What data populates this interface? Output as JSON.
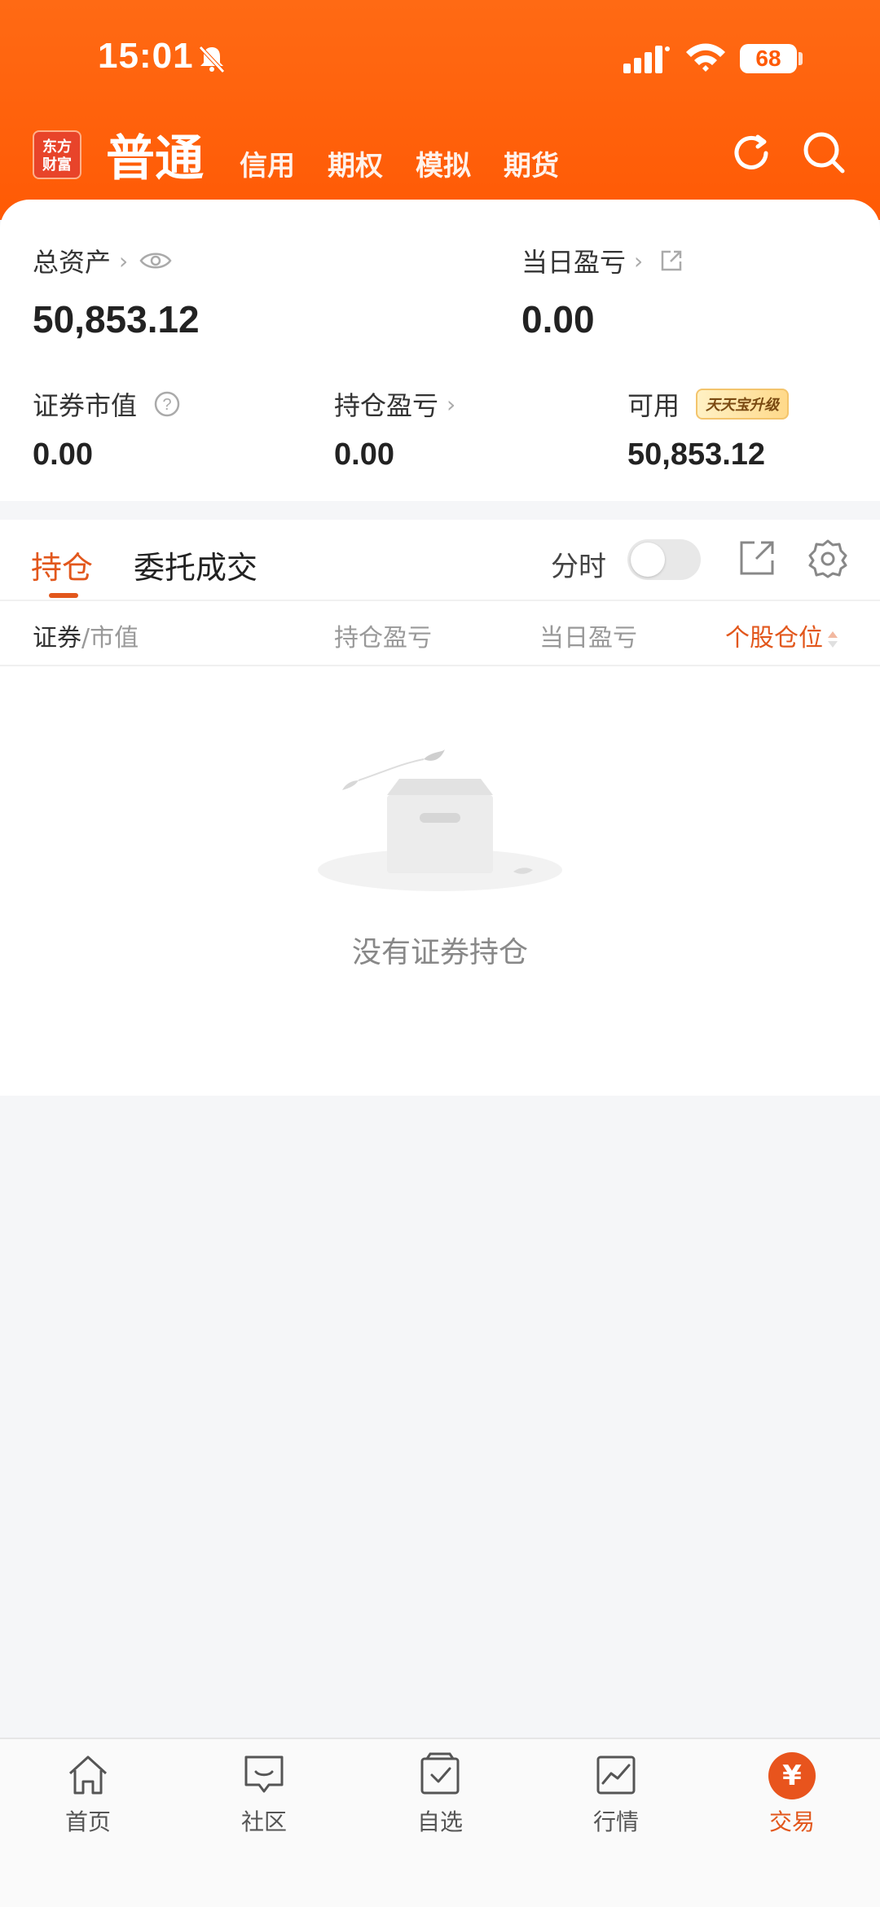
{
  "status_bar": {
    "time": "15:01",
    "battery": "68"
  },
  "header": {
    "logo_text": "东方\n财富",
    "tabs": [
      {
        "label": "普通",
        "active": true
      },
      {
        "label": "信用",
        "active": false
      },
      {
        "label": "期权",
        "active": false
      },
      {
        "label": "模拟",
        "active": false
      },
      {
        "label": "期货",
        "active": false
      }
    ]
  },
  "summary": {
    "total_assets_label": "总资产",
    "total_assets_value": "50,853.12",
    "daily_pnl_label": "当日盈亏",
    "daily_pnl_value": "0.00",
    "market_value_label": "证券市值",
    "market_value_value": "0.00",
    "holding_pnl_label": "持仓盈亏",
    "holding_pnl_value": "0.00",
    "available_label": "可用",
    "available_value": "50,853.12",
    "upgrade_badge": "天天宝升级"
  },
  "holdings": {
    "tabs": [
      "持仓",
      "委托成交"
    ],
    "timeshare_label": "分时",
    "columns": {
      "security": "证券",
      "market_value": "/市值",
      "holding_pnl": "持仓盈亏",
      "daily_pnl": "当日盈亏",
      "position": "个股仓位"
    },
    "empty_text": "没有证券持仓"
  },
  "tabbar": {
    "items": [
      {
        "label": "首页",
        "icon": "home-icon"
      },
      {
        "label": "社区",
        "icon": "community-icon"
      },
      {
        "label": "自选",
        "icon": "watchlist-icon"
      },
      {
        "label": "行情",
        "icon": "market-icon"
      },
      {
        "label": "交易",
        "icon": "trade-icon",
        "active": true
      }
    ],
    "trade_symbol": "¥"
  },
  "colors": {
    "brand_orange": "#ff5a05",
    "accent": "#e2571c"
  }
}
